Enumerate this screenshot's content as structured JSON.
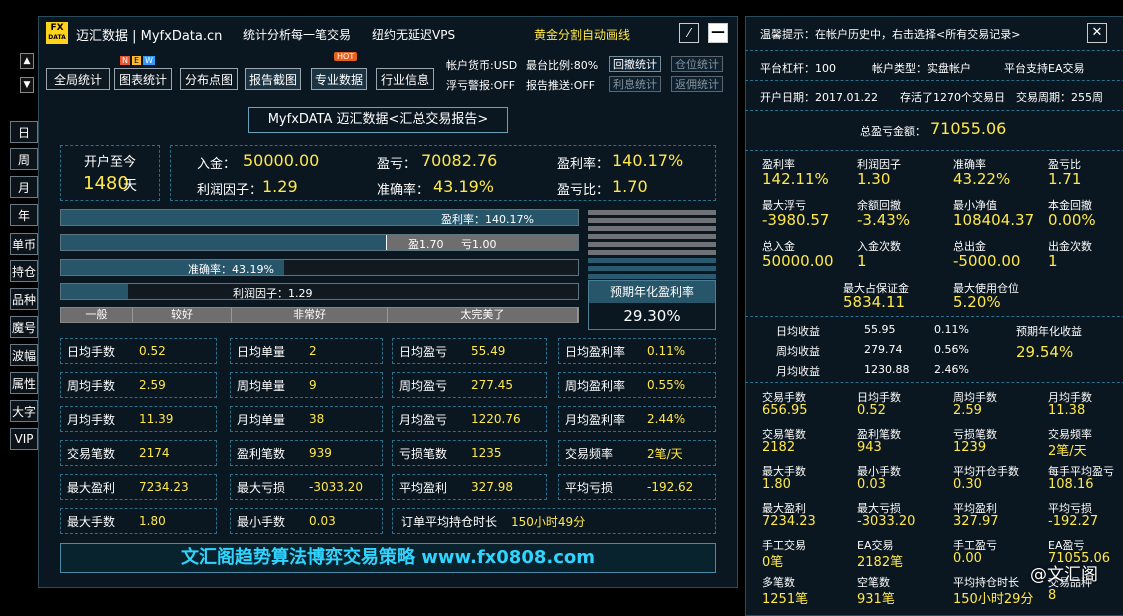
{
  "header": {
    "logo_top": "FX",
    "logo_bottom": "DATA",
    "title": "迈汇数据 | MyfxData.cn",
    "subtitle": "统计分析每一笔交易",
    "vps": "纽约无延迟VPS",
    "golden": "黄金分割自动画线"
  },
  "tabs": [
    "全局统计",
    "图表统计",
    "分布点图",
    "报告截图",
    "专业数据",
    "行业信息"
  ],
  "new_badge": [
    "N",
    "E",
    "W"
  ],
  "hot_badge": "HOT",
  "account": {
    "currency": "帐户货币:USD",
    "max_ratio": "最台比例:80%",
    "float_warn": "浮亏警报:OFF",
    "report_push": "报告推送:OFF"
  },
  "small_buttons": [
    "回撤统计",
    "仓位统计",
    "利息统计",
    "返佣统计"
  ],
  "side_menu": [
    "日",
    "周",
    "月",
    "年",
    "单币",
    "持仓",
    "品种",
    "魔号",
    "波幅",
    "属性",
    "大字",
    "VIP"
  ],
  "report_title": "MyfxDATA 迈汇数据<汇总交易报告>",
  "since_label": "开户至今",
  "since_value": "1480",
  "since_unit": "天",
  "summary": {
    "deposit_label": "入金：",
    "deposit": "50000.00",
    "profit_label": "盈亏：",
    "profit": "70082.76",
    "rate_label": "盈利率：",
    "rate": "140.17%",
    "pf_label": "利润因子：",
    "pf": "1.29",
    "acc_label": "准确率：",
    "acc": "43.19%",
    "ratio_label": "盈亏比：",
    "ratio": "1.70"
  },
  "bars": {
    "rate": {
      "text": "盈利率：140.17%",
      "fill": 1.0
    },
    "winloss": {
      "win": "盈1.70",
      "loss": "亏1.00",
      "fill": 0.63
    },
    "acc": {
      "text": "准确率：43.19%",
      "fill": 0.4319
    },
    "pf": {
      "text": "利润因子：1.29",
      "fill": 0.129
    }
  },
  "grades": [
    "一般",
    "较好",
    "非常好",
    "太完美了"
  ],
  "annual_label": "预期年化盈利率",
  "annual_value": "29.30%",
  "stats": [
    [
      [
        "日均手数",
        "0.52"
      ],
      [
        "日均单量",
        "2"
      ],
      [
        "日均盈亏",
        "55.49"
      ],
      [
        "日均盈利率",
        "0.11%"
      ]
    ],
    [
      [
        "周均手数",
        "2.59"
      ],
      [
        "周均单量",
        "9"
      ],
      [
        "周均盈亏",
        "277.45"
      ],
      [
        "周均盈利率",
        "0.55%"
      ]
    ],
    [
      [
        "月均手数",
        "11.39"
      ],
      [
        "月均单量",
        "38"
      ],
      [
        "月均盈亏",
        "1220.76"
      ],
      [
        "月均盈利率",
        "2.44%"
      ]
    ],
    [
      [
        "交易笔数",
        "2174"
      ],
      [
        "盈利笔数",
        "939"
      ],
      [
        "亏损笔数",
        "1235"
      ],
      [
        "交易频率",
        "2笔/天"
      ]
    ],
    [
      [
        "最大盈利",
        "7234.23"
      ],
      [
        "最大亏损",
        "-3033.20"
      ],
      [
        "平均盈利",
        "327.98"
      ],
      [
        "平均亏损",
        "-192.62"
      ]
    ],
    [
      [
        "最大手数",
        "1.80"
      ],
      [
        "最小手数",
        "0.03"
      ]
    ]
  ],
  "hold_label": "订单平均持仓时长",
  "hold_value": "150小时49分",
  "banner": "文汇阁趋势算法博弈交易策略  www.fx0808.com",
  "right": {
    "tip": "温馨提示：在帐户历史中，右击选择<所有交易记录>",
    "leverage": "平台杠杆：100",
    "acct_type": "帐户类型：实盘帐户",
    "ea": "平台支持EA交易",
    "open_date": "开户日期：2017.01.22",
    "days": "存活了1270个交易日",
    "cycle": "交易周期：255周",
    "total_label": "总盈亏金额：",
    "total": "71055.06",
    "grid1": [
      [
        "盈利率",
        "142.11%"
      ],
      [
        "利润因子",
        "1.30"
      ],
      [
        "准确率",
        "43.22%"
      ],
      [
        "盈亏比",
        "1.71"
      ],
      [
        "最大浮亏",
        "-3980.57"
      ],
      [
        "余额回撤",
        "-3.43%"
      ],
      [
        "最小净值",
        "108404.37"
      ],
      [
        "本金回撤",
        "0.00%"
      ],
      [
        "总入金",
        "50000.00"
      ],
      [
        "入金次数",
        "1"
      ],
      [
        "总出金",
        "-5000.00"
      ],
      [
        "出金次数",
        "1"
      ]
    ],
    "margin_label": "最大占保证金",
    "margin": "5834.11",
    "pos_label": "最大使用仓位",
    "pos": "5.20%",
    "avg": [
      [
        "日均收益",
        "55.95",
        "0.11%"
      ],
      [
        "周均收益",
        "279.74",
        "0.56%"
      ],
      [
        "月均收益",
        "1230.88",
        "2.46%"
      ]
    ],
    "annual_label": "预期年化收益",
    "annual": "29.54%",
    "grid2": [
      [
        "交易手数",
        "656.95"
      ],
      [
        "日均手数",
        "0.52"
      ],
      [
        "周均手数",
        "2.59"
      ],
      [
        "月均手数",
        "11.38"
      ],
      [
        "交易笔数",
        "2182"
      ],
      [
        "盈利笔数",
        "943"
      ],
      [
        "亏损笔数",
        "1239"
      ],
      [
        "交易频率",
        "2笔/天"
      ],
      [
        "最大手数",
        "1.80"
      ],
      [
        "最小手数",
        "0.03"
      ],
      [
        "平均开仓手数",
        "0.30"
      ],
      [
        "每手平均盈亏",
        "108.16"
      ],
      [
        "最大盈利",
        "7234.23"
      ],
      [
        "最大亏损",
        "-3033.20"
      ],
      [
        "平均盈利",
        "327.97"
      ],
      [
        "平均亏损",
        "-192.27"
      ],
      [
        "手工交易",
        "0笔"
      ],
      [
        "EA交易",
        "2182笔"
      ],
      [
        "手工盈亏",
        "0.00"
      ],
      [
        "EA盈亏",
        "71055.06"
      ],
      [
        "多笔数",
        "1251笔"
      ],
      [
        "空笔数",
        "931笔"
      ],
      [
        "平均持仓时长",
        "150小时29分"
      ],
      [
        "交易品种",
        "8"
      ]
    ]
  },
  "watermark": "@文汇阁"
}
